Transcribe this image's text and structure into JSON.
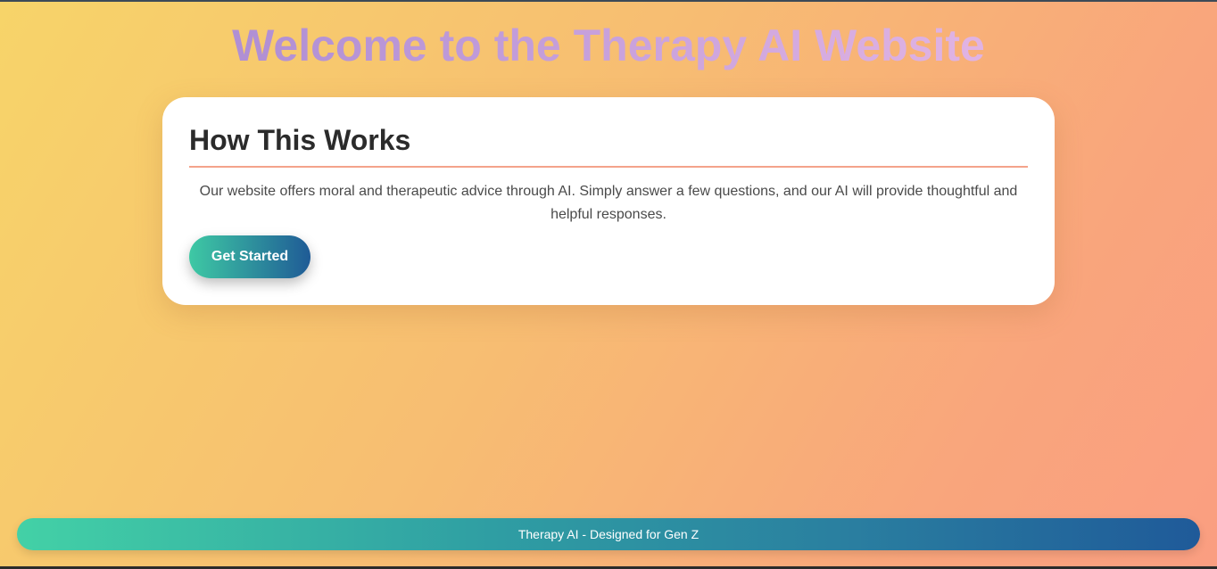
{
  "header": {
    "title": "Welcome to the Therapy AI Website"
  },
  "card": {
    "heading": "How This Works",
    "description": "Our website offers moral and therapeutic advice through AI. Simply answer a few questions, and our AI will provide thoughtful and helpful responses.",
    "button_label": "Get Started"
  },
  "footer": {
    "text": "Therapy AI - Designed for Gen Z"
  },
  "colors": {
    "background_start": "#f7d469",
    "background_end": "#fa9e81",
    "title_gradient_start": "#b08fd4",
    "title_gradient_end": "#e0b3e3",
    "accent_teal": "#3ec9a4",
    "accent_blue": "#1f5b96",
    "divider": "#f4a38b"
  }
}
